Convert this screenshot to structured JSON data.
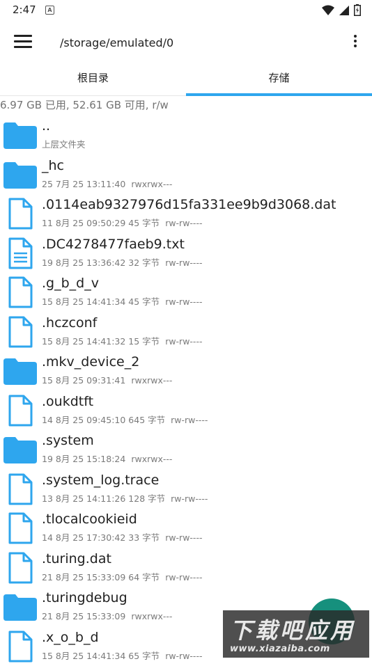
{
  "status_bar": {
    "time": "2:47",
    "notification_icon": "A"
  },
  "toolbar": {
    "path": "/storage/emulated/0"
  },
  "tabs": [
    {
      "label": "根目录"
    },
    {
      "label": "存储"
    }
  ],
  "usage": "6.97 GB 已用, 52.61 GB 可用, r/w",
  "colors": {
    "accent": "#2ea6ee",
    "folder": "#2ea6ee",
    "fab": "#16907d"
  },
  "files": [
    {
      "type": "folder",
      "name": "..",
      "meta": "上层文件夹",
      "perm": ""
    },
    {
      "type": "folder",
      "name": "_hc",
      "meta": "25 7月 25 13:11:40",
      "perm": "rwxrwx---"
    },
    {
      "type": "file",
      "name": ".0114eab9327976d15fa331ee9b9d3068.dat",
      "meta": "11 8月 25 09:50:29  45 字节",
      "perm": "rw-rw----"
    },
    {
      "type": "text",
      "name": ".DC4278477faeb9.txt",
      "meta": "19 8月 25 13:36:42  32 字节",
      "perm": "rw-rw----"
    },
    {
      "type": "file",
      "name": ".g_b_d_v",
      "meta": "15 8月 25 14:41:34  45 字节",
      "perm": "rw-rw----"
    },
    {
      "type": "file",
      "name": ".hczconf",
      "meta": "15 8月 25 14:41:32  15 字节",
      "perm": "rw-rw----"
    },
    {
      "type": "folder",
      "name": ".mkv_device_2",
      "meta": "15 8月 25 09:31:41",
      "perm": "rwxrwx---"
    },
    {
      "type": "file",
      "name": ".oukdtft",
      "meta": "14 8月 25 09:45:10  645 字节",
      "perm": "rw-rw----"
    },
    {
      "type": "folder",
      "name": ".system",
      "meta": "19 8月 25 15:18:24",
      "perm": "rwxrwx---"
    },
    {
      "type": "file",
      "name": ".system_log.trace",
      "meta": "13 8月 25 14:11:26  128 字节",
      "perm": "rw-rw----"
    },
    {
      "type": "file",
      "name": ".tlocalcookieid",
      "meta": "14 8月 25 17:30:42  33 字节",
      "perm": "rw-rw----"
    },
    {
      "type": "file",
      "name": ".turing.dat",
      "meta": "21 8月 25 15:33:09  64 字节",
      "perm": "rw-rw----"
    },
    {
      "type": "folder",
      "name": ".turingdebug",
      "meta": "21 8月 25 15:33:09",
      "perm": "rwxrwx---"
    },
    {
      "type": "file",
      "name": ".x_o_b_d",
      "meta": "15 8月 25 14:41:34  65 字节",
      "perm": "rw-rw----"
    }
  ],
  "watermark": {
    "main": "下载吧应用",
    "url": "www.xiazaiba.com"
  }
}
